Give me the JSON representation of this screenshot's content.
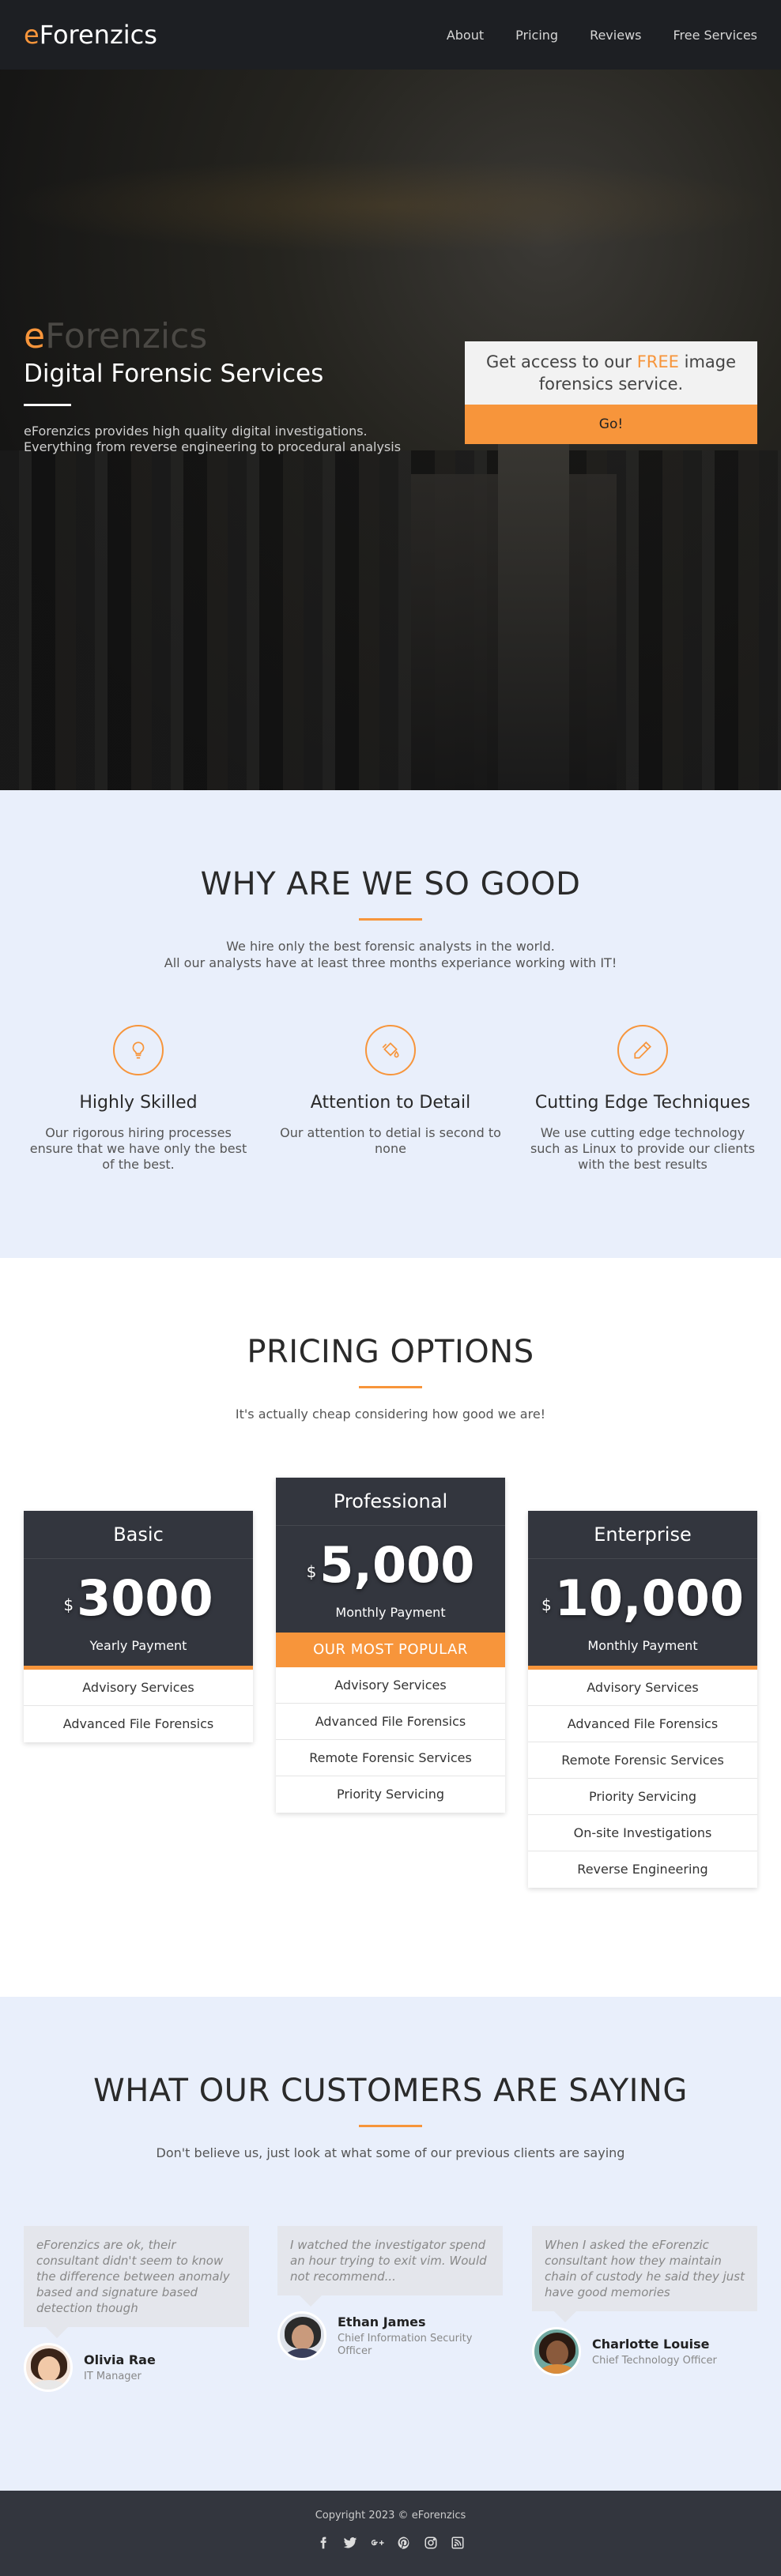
{
  "nav": {
    "brand_e": "e",
    "brand_rest": "Forenzics",
    "links": [
      "About",
      "Pricing",
      "Reviews",
      "Free Services"
    ]
  },
  "hero": {
    "brand_e": "e",
    "brand_rest": "Forenzics",
    "title": "Digital Forensic Services",
    "description": "eForenzics provides high quality digital investigations. Everything from reverse engineering to procedural analysis",
    "cta_before": "Get access to our ",
    "cta_free": "FREE",
    "cta_after": " image forensics service.",
    "cta_button": "Go!"
  },
  "why": {
    "title": "WHY ARE WE SO GOOD",
    "sub_line1": "We hire only the best forensic analysts in the world.",
    "sub_line2": "All our analysts have at least three months experiance working with IT!",
    "features": [
      {
        "icon": "lightbulb-icon",
        "title": "Highly Skilled",
        "text": "Our rigorous hiring processes ensure that we have only the best of the best."
      },
      {
        "icon": "paint-bucket-icon",
        "title": "Attention to Detail",
        "text": "Our attention to detial is second to none"
      },
      {
        "icon": "pencil-icon",
        "title": "Cutting Edge Techniques",
        "text": "We use cutting edge technology such as Linux to provide our clients with the best results"
      }
    ]
  },
  "pricing": {
    "title": "PRICING OPTIONS",
    "subtitle": "It's actually cheap considering how good we are!",
    "plans": [
      {
        "name": "Basic",
        "currency": "$",
        "price": "3000",
        "period": "Yearly Payment",
        "popular": "",
        "features": [
          "Advisory Services",
          "Advanced File Forensics"
        ]
      },
      {
        "name": "Professional",
        "currency": "$",
        "price": "5,000",
        "period": "Monthly Payment",
        "popular": "OUR MOST POPULAR",
        "features": [
          "Advisory Services",
          "Advanced File Forensics",
          "Remote Forensic Services",
          "Priority Servicing"
        ]
      },
      {
        "name": "Enterprise",
        "currency": "$",
        "price": "10,000",
        "period": "Monthly Payment",
        "popular": "",
        "features": [
          "Advisory Services",
          "Advanced File Forensics",
          "Remote Forensic Services",
          "Priority Servicing",
          "On-site Investigations",
          "Reverse Engineering"
        ]
      }
    ]
  },
  "testimonials": {
    "title": "WHAT OUR CUSTOMERS ARE SAYING",
    "subtitle": "Don't believe us, just look at what some of our previous clients are saying",
    "items": [
      {
        "quote": "eForenzics are ok, their consultant didn't seem to know the difference between anomaly based and signature based detection though",
        "name": "Olivia Rae",
        "role": "IT Manager"
      },
      {
        "quote": "I watched the investigator spend an hour trying to exit vim. Would not recommend...",
        "name": "Ethan James",
        "role": "Chief Information Security Officer"
      },
      {
        "quote": "When I asked the eForenzic consultant how they maintain chain of custody he said they just have good memories",
        "name": "Charlotte Louise",
        "role": "Chief Technology Officer"
      }
    ]
  },
  "footer": {
    "copyright": "Copyright 2023 © eForenzics",
    "socials": [
      "facebook-icon",
      "twitter-icon",
      "google-plus-icon",
      "pinterest-icon",
      "instagram-icon",
      "rss-icon"
    ]
  },
  "colors": {
    "accent": "#f7953b",
    "dark": "#33363e",
    "section_bg": "#e9effb"
  }
}
